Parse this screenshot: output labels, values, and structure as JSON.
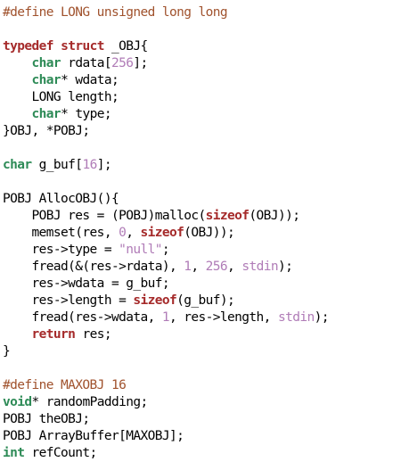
{
  "theme": {
    "background": "#ffffff",
    "text": "#000000",
    "preprocessor": "#a0522d",
    "keyword": "#a52a2a",
    "type": "#2e8b57",
    "number": "#b07cb7",
    "string": "#b07cb7"
  },
  "code_lines": [
    [
      {
        "t": "#define LONG unsigned long long",
        "c": "pp"
      }
    ],
    [],
    [
      {
        "t": "typedef",
        "c": "kw"
      },
      {
        "t": " "
      },
      {
        "t": "struct",
        "c": "kw"
      },
      {
        "t": " _OBJ{"
      }
    ],
    [
      {
        "t": "    "
      },
      {
        "t": "char",
        "c": "ty"
      },
      {
        "t": " rdata["
      },
      {
        "t": "256",
        "c": "nm"
      },
      {
        "t": "];"
      }
    ],
    [
      {
        "t": "    "
      },
      {
        "t": "char",
        "c": "ty"
      },
      {
        "t": "* wdata;"
      }
    ],
    [
      {
        "t": "    LONG length;"
      }
    ],
    [
      {
        "t": "    "
      },
      {
        "t": "char",
        "c": "ty"
      },
      {
        "t": "* type;"
      }
    ],
    [
      {
        "t": "}OBJ, *POBJ;"
      }
    ],
    [],
    [
      {
        "t": "char",
        "c": "ty"
      },
      {
        "t": " g_buf["
      },
      {
        "t": "16",
        "c": "nm"
      },
      {
        "t": "];"
      }
    ],
    [],
    [
      {
        "t": "POBJ AllocOBJ(){"
      }
    ],
    [
      {
        "t": "    POBJ res = (POBJ)malloc("
      },
      {
        "t": "sizeof",
        "c": "kw"
      },
      {
        "t": "(OBJ));"
      }
    ],
    [
      {
        "t": "    memset(res, "
      },
      {
        "t": "0",
        "c": "nm"
      },
      {
        "t": ", "
      },
      {
        "t": "sizeof",
        "c": "kw"
      },
      {
        "t": "(OBJ));"
      }
    ],
    [
      {
        "t": "    res->type = "
      },
      {
        "t": "\"null\"",
        "c": "st"
      },
      {
        "t": ";"
      }
    ],
    [
      {
        "t": "    fread(&(res->rdata), "
      },
      {
        "t": "1",
        "c": "nm"
      },
      {
        "t": ", "
      },
      {
        "t": "256",
        "c": "nm"
      },
      {
        "t": ", "
      },
      {
        "t": "stdin",
        "c": "nm"
      },
      {
        "t": ");"
      }
    ],
    [
      {
        "t": "    res->wdata = g_buf;"
      }
    ],
    [
      {
        "t": "    res->length = "
      },
      {
        "t": "sizeof",
        "c": "kw"
      },
      {
        "t": "(g_buf);"
      }
    ],
    [
      {
        "t": "    fread(res->wdata, "
      },
      {
        "t": "1",
        "c": "nm"
      },
      {
        "t": ", res->length, "
      },
      {
        "t": "stdin",
        "c": "nm"
      },
      {
        "t": ");"
      }
    ],
    [
      {
        "t": "    "
      },
      {
        "t": "return",
        "c": "kw"
      },
      {
        "t": " res;"
      }
    ],
    [
      {
        "t": "}"
      }
    ],
    [],
    [
      {
        "t": "#define MAXOBJ 16",
        "c": "pp"
      }
    ],
    [
      {
        "t": "void",
        "c": "ty"
      },
      {
        "t": "* randomPadding;"
      }
    ],
    [
      {
        "t": "POBJ theOBJ;"
      }
    ],
    [
      {
        "t": "POBJ ArrayBuffer[MAXOBJ];"
      }
    ],
    [
      {
        "t": "int",
        "c": "ty"
      },
      {
        "t": " refCount;"
      }
    ]
  ]
}
